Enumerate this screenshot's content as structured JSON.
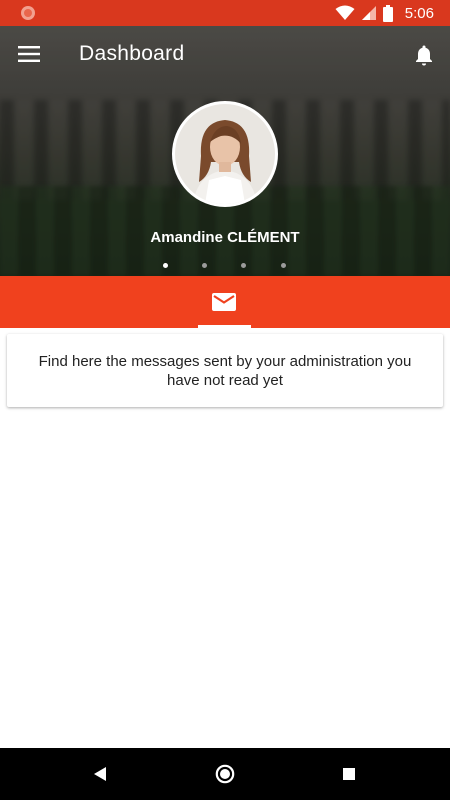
{
  "status_bar": {
    "time": "5:06",
    "icons": [
      "notification-dot-icon",
      "wifi-icon",
      "signal-icon",
      "battery-icon"
    ]
  },
  "toolbar": {
    "title": "Dashboard",
    "menu_icon": "hamburger-menu-icon",
    "notification_icon": "bell-icon"
  },
  "profile": {
    "name": "Amandine CLÉMENT",
    "pager_dots": 4,
    "active_dot": 0
  },
  "tabs": [
    {
      "icon": "mail-icon",
      "selected": true
    }
  ],
  "message_card": {
    "text": "Find here the messages sent by your administration you have not read yet"
  },
  "nav_bar": {
    "icons": [
      "back-icon",
      "home-icon",
      "recents-icon"
    ]
  },
  "colors": {
    "status_bar": "#d9381e",
    "accent": "#f0411e",
    "nav_bar": "#000000"
  }
}
